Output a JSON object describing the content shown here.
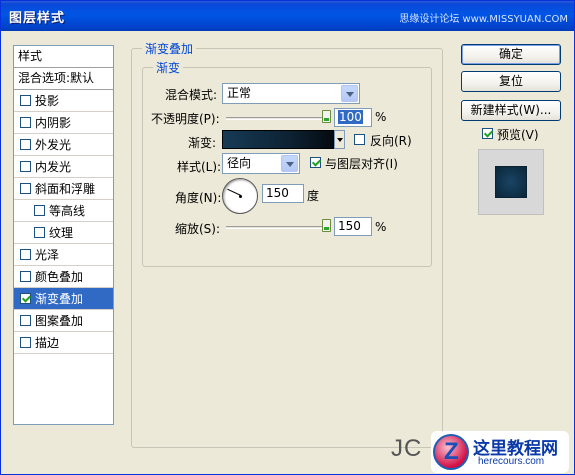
{
  "window": {
    "title": "图层样式",
    "watermark": "思缘设计论坛 www.MISSYUAN.COM"
  },
  "stylelist": {
    "header": "样式",
    "blend_options": "混合选项:默认",
    "items": [
      {
        "label": "投影",
        "checked": false,
        "indent": false,
        "active": false
      },
      {
        "label": "内阴影",
        "checked": false,
        "indent": false,
        "active": false
      },
      {
        "label": "外发光",
        "checked": false,
        "indent": false,
        "active": false
      },
      {
        "label": "内发光",
        "checked": false,
        "indent": false,
        "active": false
      },
      {
        "label": "斜面和浮雕",
        "checked": false,
        "indent": false,
        "active": false
      },
      {
        "label": "等高线",
        "checked": false,
        "indent": true,
        "active": false
      },
      {
        "label": "纹理",
        "checked": false,
        "indent": true,
        "active": false
      },
      {
        "label": "光泽",
        "checked": false,
        "indent": false,
        "active": false
      },
      {
        "label": "颜色叠加",
        "checked": false,
        "indent": false,
        "active": false
      },
      {
        "label": "渐变叠加",
        "checked": true,
        "indent": false,
        "active": true
      },
      {
        "label": "图案叠加",
        "checked": false,
        "indent": false,
        "active": false
      },
      {
        "label": "描边",
        "checked": false,
        "indent": false,
        "active": false
      }
    ]
  },
  "panel": {
    "outer_legend": "渐变叠加",
    "inner_legend": "渐变",
    "blend_mode_label": "混合模式:",
    "blend_mode_value": "正常",
    "opacity_label": "不透明度(P):",
    "opacity_value": "100",
    "opacity_level": 1.0,
    "opacity_unit": "%",
    "gradient_label": "渐变:",
    "reverse_label": "反向(R)",
    "reverse_checked": false,
    "style_label": "样式(L):",
    "style_value": "径向",
    "align_label": "与图层对齐(I)",
    "align_checked": true,
    "angle_label": "角度(N):",
    "angle_value": "150",
    "angle_unit": "度",
    "scale_label": "缩放(S):",
    "scale_value": "150",
    "scale_level": 1.0,
    "scale_unit": "%"
  },
  "buttons": {
    "ok": "确定",
    "reset": "复位",
    "new_style": "新建样式(W)...",
    "preview_label": "预览(V)",
    "preview_checked": true
  },
  "colors": {
    "gradient_start": "#173a56",
    "gradient_end": "#050b10",
    "preview_fill": "#10324b"
  },
  "logo": {
    "jc_text": "JC",
    "site_cn": "这里教程网",
    "site_en": "herecours.com"
  }
}
